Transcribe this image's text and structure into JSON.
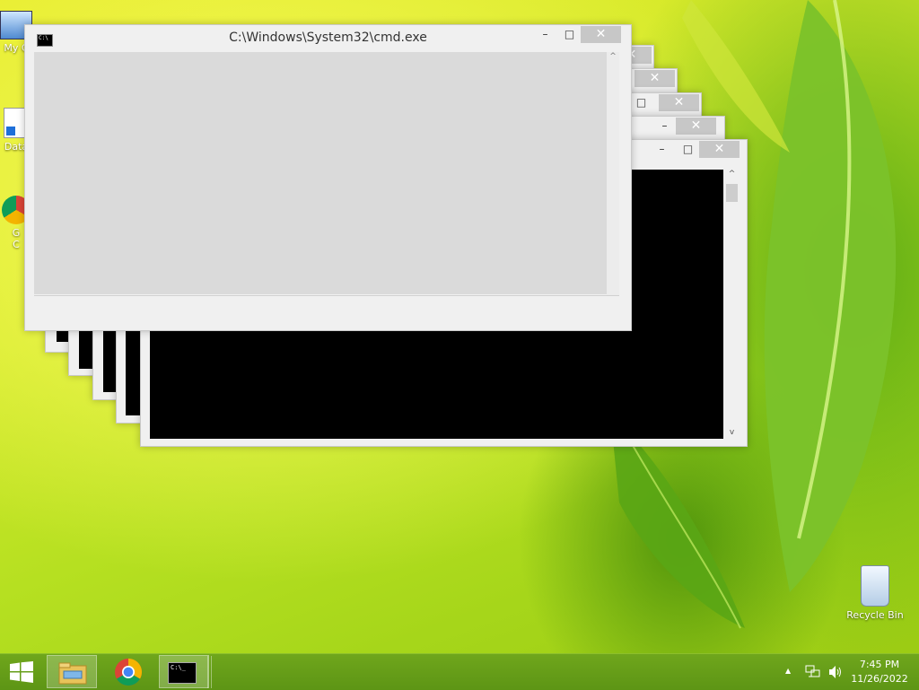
{
  "desktop": {
    "icons": [
      {
        "label": "My C"
      },
      {
        "label": "Data"
      },
      {
        "label": "G"
      },
      {
        "label": "C"
      },
      {
        "label": "Recycle Bin"
      }
    ]
  },
  "front_window": {
    "title": "C:\\Windows\\System32\\cmd.exe",
    "icon_text": "C:\\",
    "min_label": "–",
    "max_label": "□",
    "close_label": "✕"
  },
  "stacked_windows": [
    {
      "close_label": "✕"
    },
    {
      "close_label": "✕"
    },
    {
      "max_label": "□",
      "close_label": "✕"
    },
    {
      "min_label": "–",
      "max_label": "□",
      "close_label": "✕"
    },
    {
      "min_label": "–",
      "max_label": "□",
      "close_label": "✕"
    }
  ],
  "taskbar": {
    "start": "start-icon",
    "pinned": [
      "file-explorer-icon",
      "chrome-icon",
      "cmd-icon"
    ],
    "cmd_text": "C:\\_",
    "tray": {
      "time": "7:45 PM",
      "date": "11/26/2022",
      "show_hidden": "▲"
    }
  },
  "colors": {
    "taskbar": "#5d9515",
    "close_button": "#c7c7c7",
    "console_bg": "#000000"
  }
}
